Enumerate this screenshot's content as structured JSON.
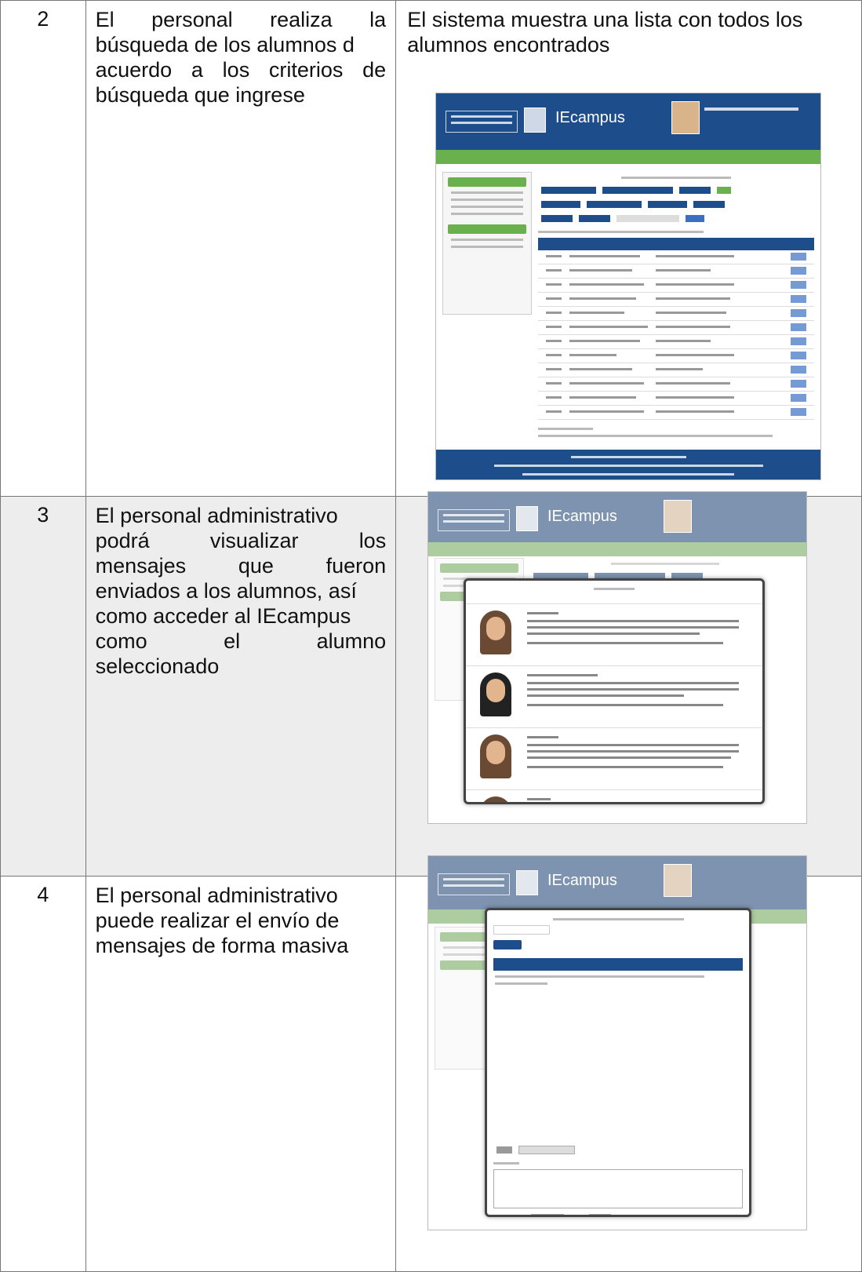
{
  "rows": [
    {
      "num": "2",
      "desc_lines": [
        "El personal realiza la",
        "búsqueda de los alumnos d",
        "acuerdo a los criterios de",
        "búsqueda que ingrese"
      ],
      "result_text": "El sistema muestra una lista con todos los alumnos encontrados"
    },
    {
      "num": "3",
      "desc_lines": [
        "El personal administrativo",
        "podrá visualizar los",
        "mensajes que fueron",
        "enviados a los alumnos, así",
        "como acceder al IEcampus",
        "como el alumno",
        "seleccionado"
      ],
      "result_text": ""
    },
    {
      "num": "4",
      "desc_lines": [
        "El personal administrativo",
        "puede realizar el envío de",
        "mensajes de forma masiva"
      ],
      "result_text": ""
    }
  ],
  "screens": {
    "brand": "IEcampus",
    "colors": {
      "header": "#1e4d8c",
      "bar": "#6ab04c"
    }
  }
}
